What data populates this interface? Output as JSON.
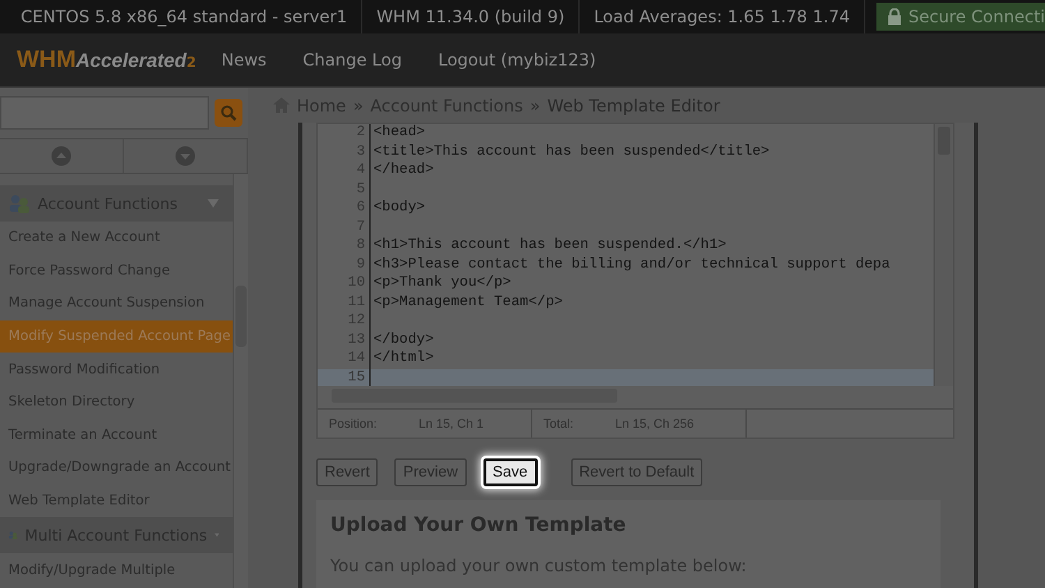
{
  "top_bar": {
    "items": [
      "CENTOS 5.8 x86_64 standard - server1",
      "WHM 11.34.0 (build 9)",
      "Load Averages: 1.65 1.78 1.74"
    ],
    "secure": "Secure Connecti"
  },
  "logo": {
    "name": "WHM",
    "accent": "Accelerated",
    "version": "2"
  },
  "nav": [
    "News",
    "Change Log",
    "Logout (mybiz123)"
  ],
  "breadcrumb": {
    "separator": "»",
    "items": [
      "Home",
      "Account Functions",
      "Web Template Editor"
    ]
  },
  "sidebar": {
    "groups": [
      {
        "title": "Account Functions",
        "items": [
          {
            "label": "Create a New Account",
            "selected": false
          },
          {
            "label": "Force Password Change",
            "selected": false
          },
          {
            "label": "Manage Account Suspension",
            "selected": false
          },
          {
            "label": "Modify Suspended Account Page",
            "selected": true
          },
          {
            "label": "Password Modification",
            "selected": false
          },
          {
            "label": "Skeleton Directory",
            "selected": false
          },
          {
            "label": "Terminate an Account",
            "selected": false
          },
          {
            "label": "Upgrade/Downgrade an Account",
            "selected": false
          },
          {
            "label": "Web Template Editor",
            "selected": false
          }
        ]
      },
      {
        "title": "Multi Account Functions",
        "items": [
          {
            "label": "Modify/Upgrade Multiple",
            "selected": false
          }
        ]
      }
    ]
  },
  "editor": {
    "lines": [
      {
        "number": "2",
        "code": "<head>",
        "current": false
      },
      {
        "number": "3",
        "code": "<title>This account has been suspended</title>",
        "current": false
      },
      {
        "number": "4",
        "code": "</head>",
        "current": false
      },
      {
        "number": "5",
        "current": false
      },
      {
        "number": "6",
        "code": "<body>",
        "current": false
      },
      {
        "number": "7",
        "current": false
      },
      {
        "number": "8",
        "code": "<h1>This account has been suspended.</h1>",
        "current": false
      },
      {
        "number": "9",
        "code": "<h3>Please contact the billing and/or technical support depa",
        "current": false
      },
      {
        "number": "10",
        "code": "<p>Thank you</p>",
        "current": false
      },
      {
        "number": "11",
        "code": "<p>Management Team</p>",
        "current": false
      },
      {
        "number": "12",
        "current": false
      },
      {
        "number": "13",
        "code": "</body>",
        "current": false
      },
      {
        "number": "14",
        "code": "</html>",
        "current": false
      },
      {
        "number": "15",
        "current": true
      }
    ],
    "status": {
      "position_label": "Position:",
      "position": "Ln 15, Ch 1",
      "total_label": "Total:",
      "total": "Ln 15, Ch 256"
    }
  },
  "buttons": [
    {
      "label": "Revert",
      "focused": false
    },
    {
      "label": "Preview",
      "focused": false
    },
    {
      "label": "Save",
      "focused": true
    },
    {
      "label": "Revert to Default",
      "focused": false
    }
  ],
  "upload": {
    "heading": "Upload Your Own Template",
    "text": "You can upload your own custom template below:"
  }
}
